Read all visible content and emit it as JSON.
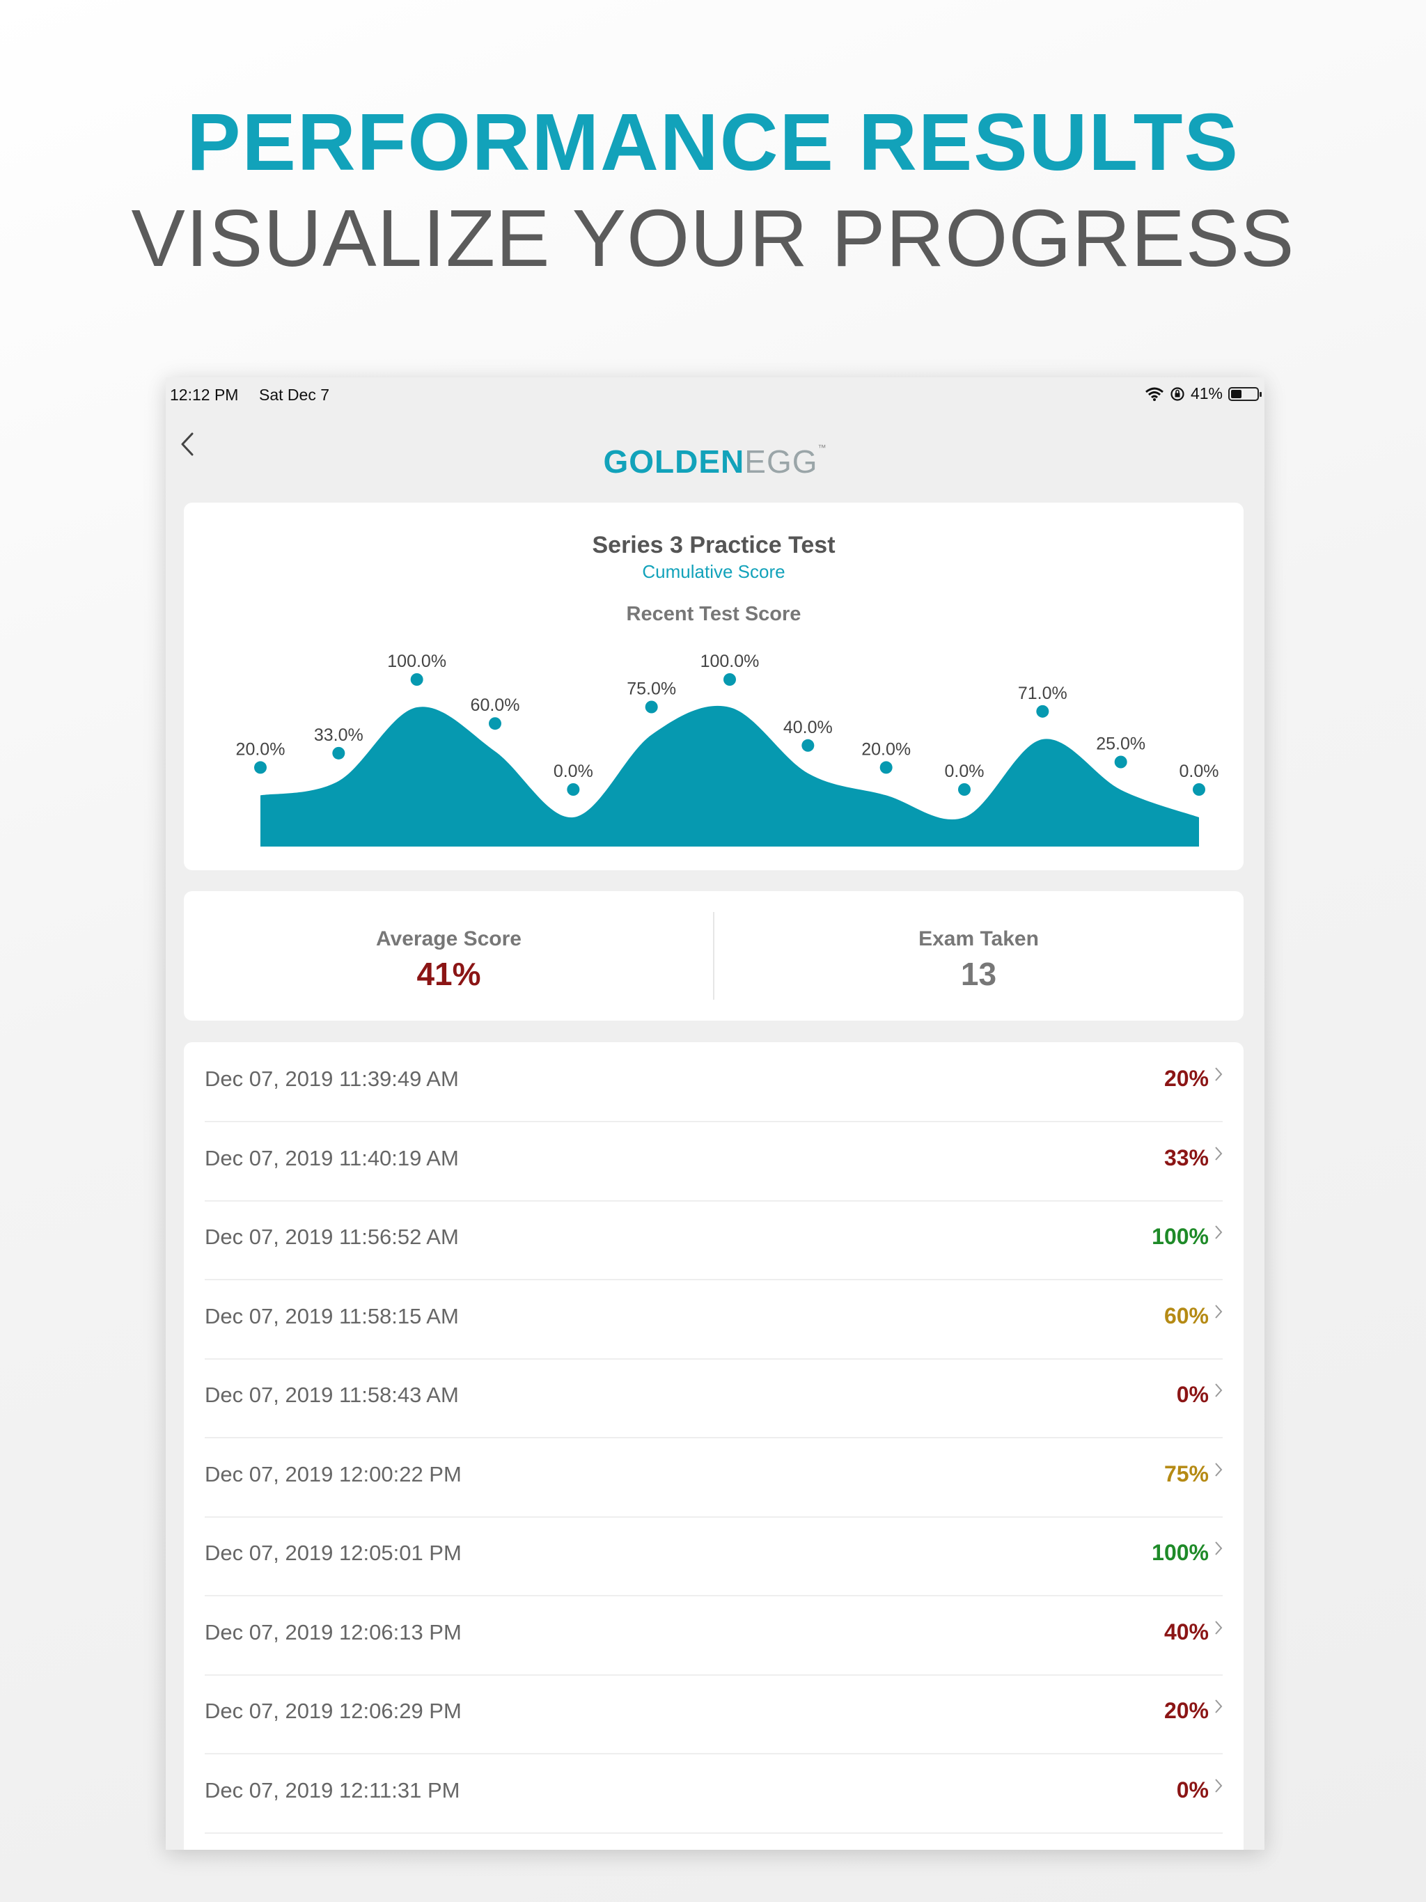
{
  "headline": {
    "title": "PERFORMANCE RESULTS",
    "subtitle": "VISUALIZE YOUR PROGRESS"
  },
  "status_bar": {
    "time": "12:12 PM",
    "date": "Sat Dec 7",
    "battery": "41%",
    "battery_level": 0.41
  },
  "nav": {
    "back_icon": "chevron-left-icon",
    "logo_part1": "GOLDEN",
    "logo_part2": "EGG",
    "logo_tm": "™"
  },
  "chart_card": {
    "title": "Series 3 Practice Test",
    "subtitle": "Cumulative Score",
    "label": "Recent Test Score"
  },
  "chart_data": {
    "type": "area",
    "title": "Recent Test Score",
    "x": [
      1,
      2,
      3,
      4,
      5,
      6,
      7,
      8,
      9,
      10,
      11,
      12,
      13
    ],
    "values": [
      20,
      33,
      100,
      60,
      0,
      75,
      100,
      40,
      20,
      0,
      71,
      25,
      0
    ],
    "data_labels": [
      "20.0%",
      "33.0%",
      "100.0%",
      "60.0%",
      "0.0%",
      "75.0%",
      "100.0%",
      "40.0%",
      "20.0%",
      "0.0%",
      "71.0%",
      "25.0%",
      "0.0%"
    ],
    "ylim": [
      0,
      100
    ],
    "grid": false,
    "legend": false,
    "color": "#0699b0"
  },
  "stats": {
    "average_label": "Average Score",
    "average_value": "41%",
    "exam_label": "Exam Taken",
    "exam_value": "13"
  },
  "colors": {
    "accent": "#12a2ba",
    "low": "#8b1515",
    "mid": "#b58a14",
    "high": "#1e8a28",
    "neutral": "#777777"
  },
  "results": [
    {
      "date": "Dec 07, 2019 11:39:49 AM",
      "score": "20%",
      "level": "low"
    },
    {
      "date": "Dec 07, 2019 11:40:19 AM",
      "score": "33%",
      "level": "low"
    },
    {
      "date": "Dec 07, 2019 11:56:52 AM",
      "score": "100%",
      "level": "high"
    },
    {
      "date": "Dec 07, 2019 11:58:15 AM",
      "score": "60%",
      "level": "mid"
    },
    {
      "date": "Dec 07, 2019 11:58:43 AM",
      "score": "0%",
      "level": "low"
    },
    {
      "date": "Dec 07, 2019 12:00:22 PM",
      "score": "75%",
      "level": "mid"
    },
    {
      "date": "Dec 07, 2019 12:05:01 PM",
      "score": "100%",
      "level": "high"
    },
    {
      "date": "Dec 07, 2019 12:06:13 PM",
      "score": "40%",
      "level": "low"
    },
    {
      "date": "Dec 07, 2019 12:06:29 PM",
      "score": "20%",
      "level": "low"
    },
    {
      "date": "Dec 07, 2019 12:11:31 PM",
      "score": "0%",
      "level": "low"
    }
  ]
}
